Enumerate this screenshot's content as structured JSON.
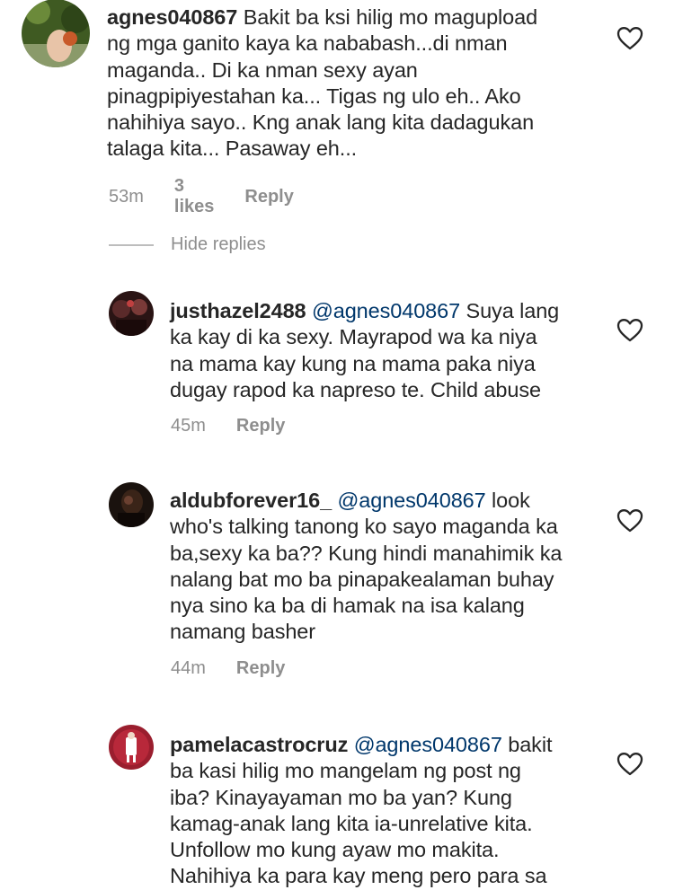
{
  "comments": [
    {
      "username": "agnes040867",
      "mention": "",
      "lines": [
        "Bakit ba ksi hilig mo magupload",
        "ng mga ganito kaya ka nababash...di nman",
        "maganda.. Di ka nman sexy ayan",
        "pinagpipiyestahan ka... Tigas ng ulo eh.. Ako",
        "nahihiya sayo.. Kng anak lang kita dadagukan",
        "talaga kita... Pasaway eh..."
      ],
      "time": "53m",
      "likes": "3 likes",
      "reply": "Reply",
      "avatar_color": "#4a6b2a"
    },
    {
      "username": "justhazel2488",
      "mention": "@agnes040867",
      "lines": [
        "Suya lang",
        "ka kay di ka sexy. Mayrapod wa ka niya",
        "na mama kay kung na mama paka niya",
        "dugay rapod ka napreso te. Child abuse"
      ],
      "time": "45m",
      "likes": "",
      "reply": "Reply",
      "avatar_color": "#3a1e1e"
    },
    {
      "username": "aldubforever16_",
      "mention": "@agnes040867",
      "lines": [
        "look",
        "who's talking tanong ko sayo maganda ka",
        "ba,sexy ka ba?? Kung hindi manahimik ka",
        "nalang bat mo ba pinapakealaman buhay",
        "nya sino ka ba di hamak na isa kalang",
        "namang basher"
      ],
      "time": "44m",
      "likes": "",
      "reply": "Reply",
      "avatar_color": "#2a1a14"
    },
    {
      "username": "pamelacastrocruz",
      "mention": "@agnes040867",
      "lines": [
        "bakit",
        "ba kasi hilig mo mangelam ng post ng",
        "iba? Kinayayaman mo ba yan? Kung",
        "kamag-anak lang kita ia-unrelative kita.",
        "Unfollow mo kung ayaw mo makita.",
        "Nahihiya ka para kay meng pero para sa"
      ],
      "time": "",
      "likes": "",
      "reply": "",
      "avatar_color": "#8a1c2a"
    }
  ],
  "hide_replies": "Hide replies",
  "icons": {
    "like": "heart-icon"
  }
}
